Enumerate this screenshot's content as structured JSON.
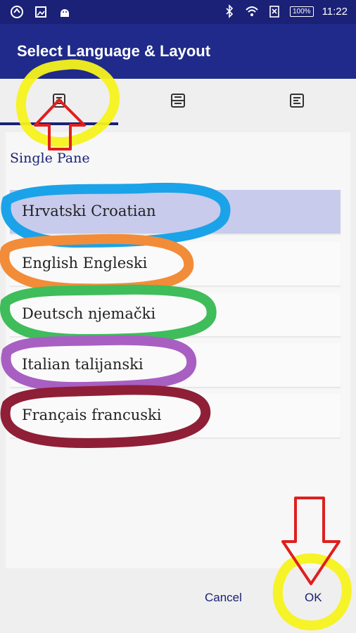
{
  "status_bar": {
    "time": "11:22",
    "battery": "100%",
    "icons": [
      "app-logo-icon",
      "image-icon",
      "android-icon",
      "bluetooth-icon",
      "wifi-icon",
      "no-sim-icon",
      "battery-icon"
    ]
  },
  "app_bar": {
    "title": "Select Language & Layout"
  },
  "tabs": [
    {
      "icon": "single-pane-icon",
      "selected": true
    },
    {
      "icon": "split-pane-icon",
      "selected": false
    },
    {
      "icon": "text-pane-icon",
      "selected": false
    }
  ],
  "pane": {
    "title": "Single Pane",
    "items": [
      {
        "label": "Hrvatski Croatian",
        "selected": true
      },
      {
        "label": "English Engleski",
        "selected": false
      },
      {
        "label": "Deutsch njemački",
        "selected": false
      },
      {
        "label": "Italian talijanski",
        "selected": false
      },
      {
        "label": "Français francuski",
        "selected": false
      }
    ]
  },
  "dialog_buttons": {
    "cancel": "Cancel",
    "ok": "OK"
  },
  "colors": {
    "primary": "#1f2a8a",
    "primary_dark": "#1a2176",
    "selected_item": "#c8cbec",
    "annotation_yellow": "#f6f21e",
    "annotation_red": "#e01e1e",
    "annotation_blue": "#1aa3e8",
    "annotation_orange": "#f28c38",
    "annotation_green": "#3ebd5a",
    "annotation_purple": "#a85fc2",
    "annotation_maroon": "#8e1f37"
  }
}
